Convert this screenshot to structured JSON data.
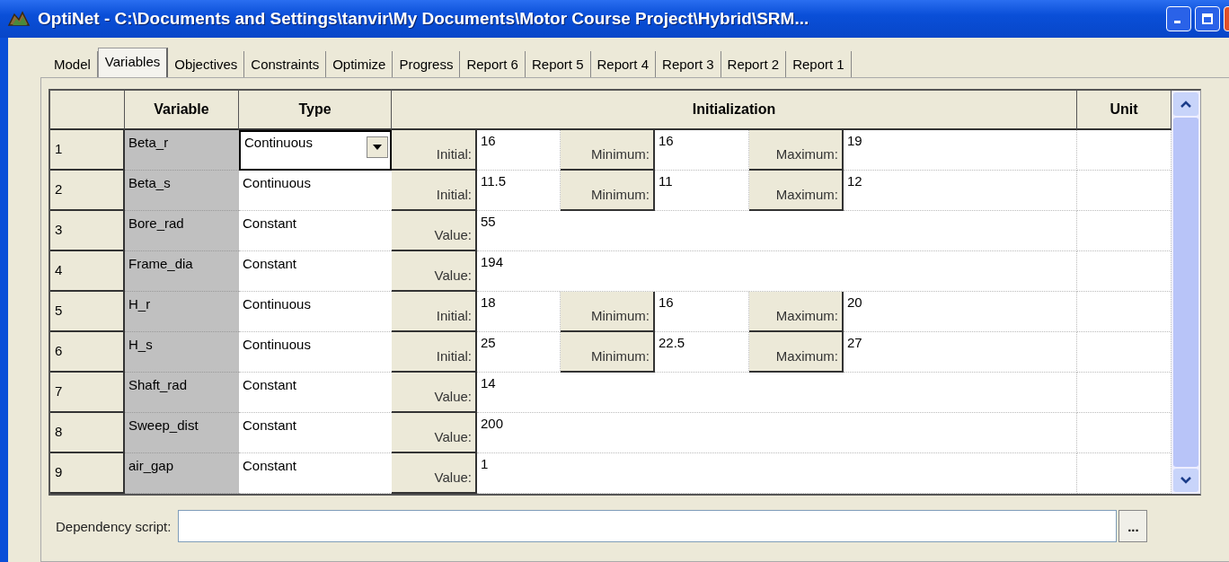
{
  "window": {
    "title": "OptiNet - C:\\Documents and Settings\\tanvir\\My Documents\\Motor Course Project\\Hybrid\\SRM..."
  },
  "tabs": [
    {
      "label": "Model",
      "selected": false
    },
    {
      "label": "Variables",
      "selected": true
    },
    {
      "label": "Objectives",
      "selected": false
    },
    {
      "label": "Constraints",
      "selected": false
    },
    {
      "label": "Optimize",
      "selected": false
    },
    {
      "label": "Progress",
      "selected": false
    },
    {
      "label": "Report 6",
      "selected": false
    },
    {
      "label": "Report 5",
      "selected": false
    },
    {
      "label": "Report 4",
      "selected": false
    },
    {
      "label": "Report 3",
      "selected": false
    },
    {
      "label": "Report 2",
      "selected": false
    },
    {
      "label": "Report 1",
      "selected": false
    }
  ],
  "table": {
    "columns": [
      "Variable",
      "Type",
      "Initialization",
      "Unit"
    ],
    "rows": [
      {
        "number": "1",
        "variable": "Beta_r",
        "type": "Continuous",
        "selected": true,
        "kind": "range",
        "initial_label": "Initial:",
        "initial": "16",
        "minimum_label": "Minimum:",
        "minimum": "16",
        "maximum_label": "Maximum:",
        "maximum": "19"
      },
      {
        "number": "2",
        "variable": "Beta_s",
        "type": "Continuous",
        "selected": false,
        "kind": "range",
        "initial_label": "Initial:",
        "initial": "11.5",
        "minimum_label": "Minimum:",
        "minimum": "11",
        "maximum_label": "Maximum:",
        "maximum": "12"
      },
      {
        "number": "3",
        "variable": "Bore_rad",
        "type": "Constant",
        "selected": false,
        "kind": "constant",
        "value_label": "Value:",
        "value": "55"
      },
      {
        "number": "4",
        "variable": "Frame_dia",
        "type": "Constant",
        "selected": false,
        "kind": "constant",
        "value_label": "Value:",
        "value": "194"
      },
      {
        "number": "5",
        "variable": "H_r",
        "type": "Continuous",
        "selected": false,
        "kind": "range",
        "initial_label": "Initial:",
        "initial": "18",
        "minimum_label": "Minimum:",
        "minimum": "16",
        "maximum_label": "Maximum:",
        "maximum": "20"
      },
      {
        "number": "6",
        "variable": "H_s",
        "type": "Continuous",
        "selected": false,
        "kind": "range",
        "initial_label": "Initial:",
        "initial": "25",
        "minimum_label": "Minimum:",
        "minimum": "22.5",
        "maximum_label": "Maximum:",
        "maximum": "27"
      },
      {
        "number": "7",
        "variable": "Shaft_rad",
        "type": "Constant",
        "selected": false,
        "kind": "constant",
        "value_label": "Value:",
        "value": "14"
      },
      {
        "number": "8",
        "variable": "Sweep_dist",
        "type": "Constant",
        "selected": false,
        "kind": "constant",
        "value_label": "Value:",
        "value": "200"
      },
      {
        "number": "9",
        "variable": "air_gap",
        "type": "Constant",
        "selected": false,
        "kind": "constant",
        "value_label": "Value:",
        "value": "1"
      }
    ]
  },
  "dependency_script": {
    "label": "Dependency script:",
    "button": "..."
  }
}
